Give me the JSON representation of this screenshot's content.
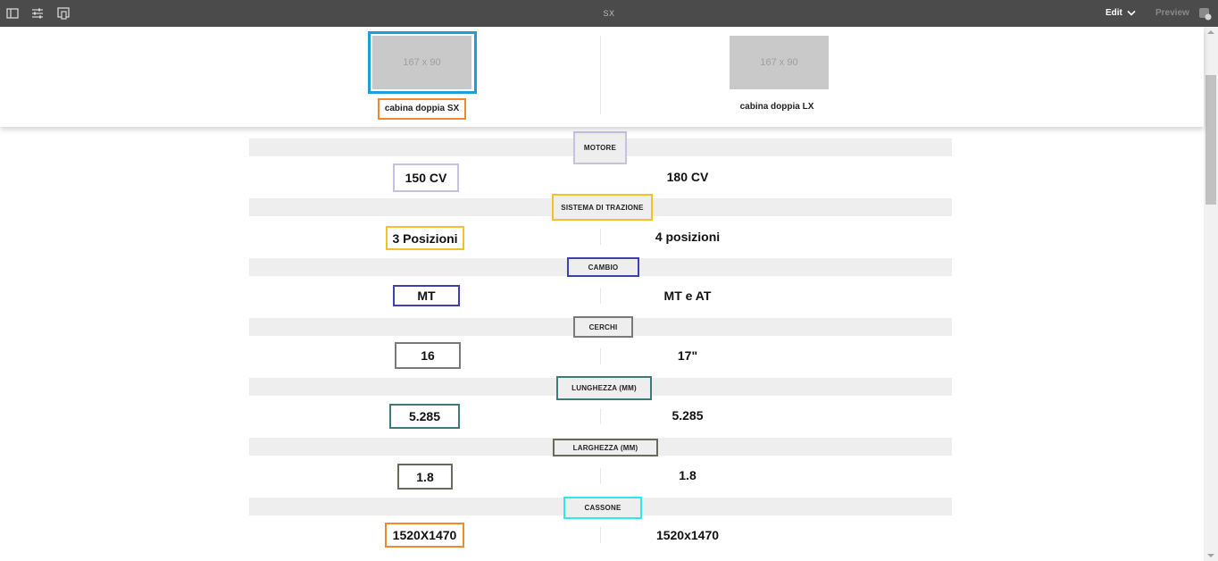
{
  "toolbar": {
    "title": "SX",
    "edit_label": "Edit",
    "preview_label": "Preview",
    "icons": [
      "side-panel-icon",
      "properties-icon",
      "emulator-icon",
      "annotations-icon"
    ]
  },
  "header": {
    "models": [
      {
        "image_label": "167 x 90",
        "name": "cabina doppia SX"
      },
      {
        "image_label": "167 x 90",
        "name": "cabina doppia LX"
      }
    ]
  },
  "specs": [
    {
      "label": "MOTORE",
      "left": "150 CV",
      "right": "180 CV"
    },
    {
      "label": "SISTEMA DI TRAZIONE",
      "left": "3 Posizioni",
      "right": "4 posizioni"
    },
    {
      "label": "CAMBIO",
      "left": "MT",
      "right": "MT e AT"
    },
    {
      "label": "CERCHI",
      "left": "16",
      "right": "17\""
    },
    {
      "label": "LUNGHEZZA (MM)",
      "left": "5.285",
      "right": "5.285"
    },
    {
      "label": "LARGHEZZA (MM)",
      "left": "1.8",
      "right": "1.8"
    },
    {
      "label": "CASSONE",
      "left": "1520X1470",
      "right": "1520x1470"
    }
  ],
  "colors": {
    "toolbar_bg": "#4b4b4b",
    "selected_image_border": "#1ea0d6",
    "name_border": "#f08a2c",
    "motore_border": "#c8c0e0",
    "trazione_border": "#f5c02a",
    "cambio_border": "#3f3fb0",
    "cerchi_border": "#7a7a7a",
    "lunghezza_border": "#3e7a78",
    "larghezza_border": "#6a6a5a",
    "cassone_border": "#2ee8ee",
    "cassone_value_border": "#f08a2c"
  }
}
